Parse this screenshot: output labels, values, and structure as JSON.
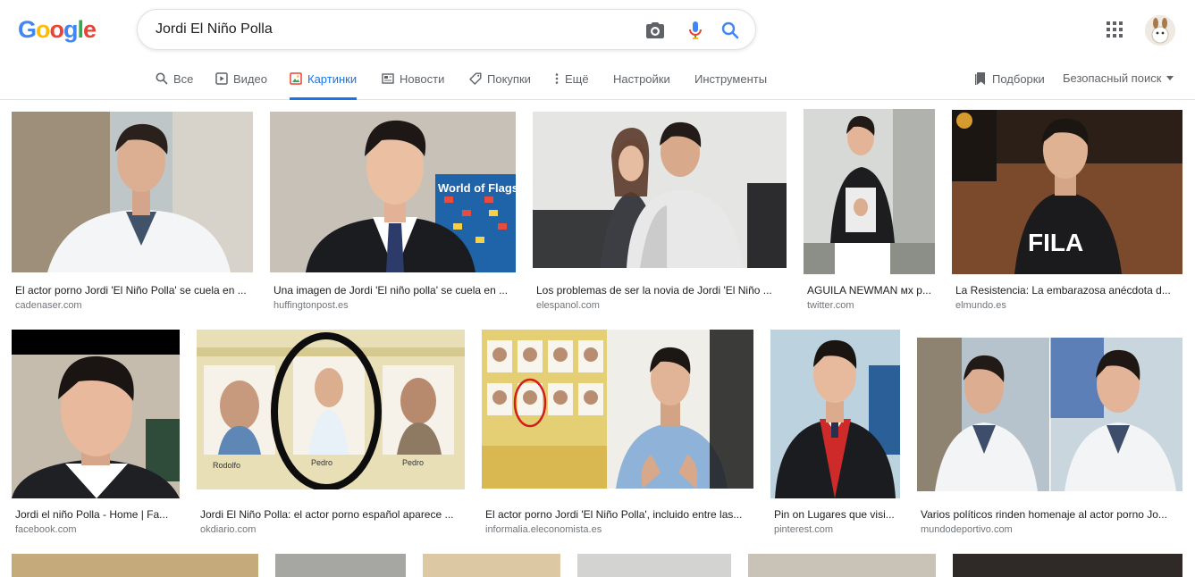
{
  "brand": {
    "logo_text": "Google",
    "colors": {
      "blue": "#4285f4",
      "red": "#ea4335",
      "yellow": "#fbbc05",
      "green": "#34a853",
      "accent": "#1a73e8"
    }
  },
  "search": {
    "query": "Jordi El Niño Polla",
    "icons": [
      "camera-icon",
      "microphone-icon",
      "search-icon"
    ]
  },
  "header_right": {
    "icons": [
      "apps-grid-icon",
      "avatar"
    ]
  },
  "tabs": [
    {
      "label": "Все",
      "icon": "search-icon",
      "active": false
    },
    {
      "label": "Видео",
      "icon": "video-icon",
      "active": false
    },
    {
      "label": "Картинки",
      "icon": "image-icon",
      "active": true
    },
    {
      "label": "Новости",
      "icon": "news-icon",
      "active": false
    },
    {
      "label": "Покупки",
      "icon": "tag-icon",
      "active": false
    },
    {
      "label": "Ещё",
      "icon": "more-vert-icon",
      "active": false
    },
    {
      "label": "Настройки",
      "icon": "",
      "active": false
    },
    {
      "label": "Инструменты",
      "icon": "",
      "active": false
    }
  ],
  "right_tools": {
    "collections_label": "Подборки",
    "safe_search_label": "Безопасный поиск"
  },
  "results": [
    {
      "caption": "El actor porno Jordi 'El Niño Polla' se cuela en ...",
      "domain": "cadenaser.com"
    },
    {
      "caption": "Una imagen de Jordi 'El niño polla' se cuela en ...",
      "domain": "huffingtonpost.es"
    },
    {
      "caption": "Los problemas de ser la novia de Jordi 'El Niño ...",
      "domain": "elespanol.com"
    },
    {
      "caption": "AGUILA NEWMAN мх p...",
      "domain": "twitter.com"
    },
    {
      "caption": "La Resistencia: La embarazosa anécdota d...",
      "domain": "elmundo.es"
    },
    {
      "caption": "Jordi el niño Polla - Home | Fa...",
      "domain": "facebook.com"
    },
    {
      "caption": "Jordi El Niño Polla: el actor porno español aparece ...",
      "domain": "okdiario.com"
    },
    {
      "caption": "El actor porno Jordi 'El Niño Polla', incluido entre las...",
      "domain": "informalia.eleconomista.es"
    },
    {
      "caption": "Pin on Lugares que visi...",
      "domain": "pinterest.com"
    },
    {
      "caption": "Varios políticos rinden homenaje al actor porno Jo...",
      "domain": "mundodeportivo.com"
    }
  ]
}
